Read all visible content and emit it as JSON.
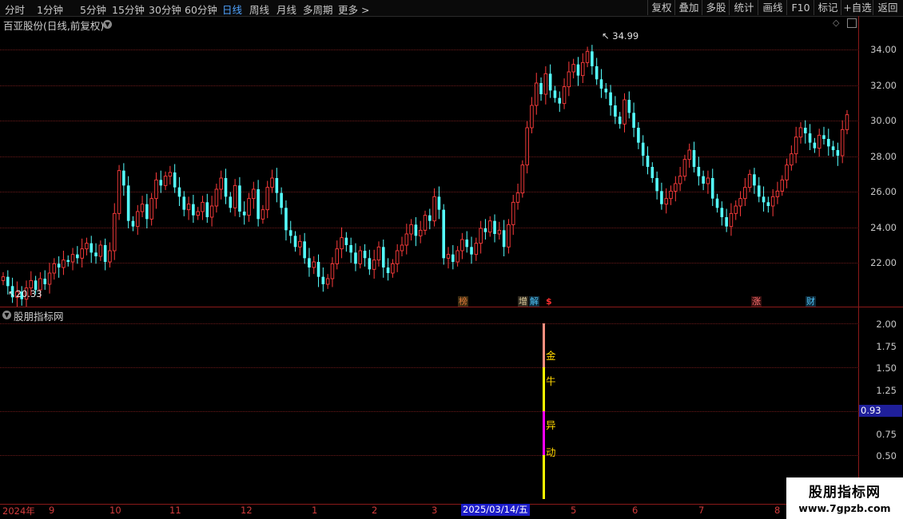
{
  "toolbar": {
    "periods": [
      "分时",
      "1分钟",
      "5分钟",
      "15分钟",
      "30分钟",
      "60分钟",
      "日线",
      "周线",
      "月线",
      "多周期",
      "更多 >"
    ],
    "active_period": "日线",
    "tools": [
      "复权",
      "叠加",
      "多股",
      "统计",
      "画线",
      "F10",
      "标记",
      "+自选",
      "返回"
    ]
  },
  "main_chart": {
    "title": "百亚股份(日线,前复权)",
    "high_label": "34.99",
    "low_label": "20.33",
    "event_markers": [
      {
        "text": "榜",
        "color": "#e07b39"
      },
      {
        "text": "增",
        "color": "#e0d0a0"
      },
      {
        "text": "解",
        "color": "#4fc3f7"
      },
      {
        "text": "$",
        "color": "#ff3030"
      },
      {
        "text": "涨",
        "color": "#ff7070"
      },
      {
        "text": "财",
        "color": "#4fc3f7"
      }
    ]
  },
  "indicator": {
    "title": "股朋指标网",
    "current_value": "0.93",
    "labels": [
      "金",
      "牛",
      "异",
      "动"
    ]
  },
  "date_cursor": "2025/03/14/五",
  "watermark": {
    "line1": "股朋指标网",
    "line2": "www.7gpzb.com"
  },
  "colors": {
    "up": "#ff3c3c",
    "down": "#55ffff",
    "grid": "#6e1a1a",
    "accent": "#4fa3ff"
  },
  "chart_data": [
    {
      "type": "candlestick",
      "ylim": [
        20.0,
        35.6
      ],
      "yticks": [
        "22.00",
        "24.00",
        "26.00",
        "28.00",
        "30.00",
        "32.00",
        "34.00"
      ],
      "xlabels": [
        "2024年",
        "9",
        "10",
        "11",
        "12",
        "1",
        "2",
        "3",
        "4",
        "5",
        "6",
        "7",
        "8"
      ],
      "close_series": [
        21.6,
        21.1,
        20.5,
        20.8,
        20.4,
        21.0,
        21.4,
        20.9,
        21.5,
        21.2,
        21.8,
        22.3,
        22.1,
        22.5,
        22.4,
        22.8,
        22.6,
        23.1,
        23.4,
        22.9,
        22.7,
        23.3,
        22.4,
        23.0,
        25.0,
        27.3,
        26.5,
        24.6,
        24.3,
        25.1,
        25.5,
        24.7,
        25.8,
        26.8,
        26.5,
        27.0,
        27.2,
        26.4,
        25.9,
        25.2,
        25.5,
        24.9,
        25.1,
        25.6,
        24.8,
        25.4,
        26.3,
        26.9,
        25.9,
        25.3,
        26.5,
        25.1,
        24.9,
        25.8,
        26.3,
        24.7,
        25.2,
        26.4,
        26.9,
        26.1,
        25.3,
        24.1,
        23.8,
        23.2,
        23.5,
        22.6,
        22.1,
        22.4,
        21.6,
        21.2,
        21.5,
        22.3,
        23.1,
        23.7,
        23.3,
        22.9,
        22.3,
        23.0,
        22.6,
        22.0,
        22.5,
        23.2,
        22.1,
        21.8,
        22.3,
        23.0,
        23.3,
        23.9,
        24.4,
        23.8,
        24.1,
        24.9,
        24.6,
        25.9,
        25.2,
        22.6,
        22.8,
        22.4,
        23.0,
        23.6,
        23.2,
        22.8,
        23.4,
        24.2,
        24.0,
        24.6,
        23.9,
        24.1,
        23.2,
        24.4,
        25.6,
        26.1,
        27.6,
        29.6,
        30.8,
        32.0,
        31.4,
        32.5,
        31.6,
        31.2,
        30.9,
        31.8,
        32.6,
        33.0,
        32.4,
        33.1,
        33.7,
        32.9,
        32.2,
        31.7,
        31.5,
        30.8,
        30.2,
        29.8,
        31.1,
        30.4,
        29.6,
        28.8,
        28.1,
        27.5,
        26.9,
        26.2,
        25.5,
        25.8,
        26.2,
        26.6,
        27.0,
        27.9,
        28.4,
        27.5,
        27.0,
        26.6,
        26.9,
        25.8,
        25.3,
        24.8,
        24.3,
        25.0,
        25.4,
        25.8,
        26.4,
        27.1,
        26.5,
        25.9,
        25.6,
        25.4,
        25.9,
        26.2,
        26.8,
        27.6,
        28.2,
        29.1,
        29.6,
        29.3,
        28.8,
        28.5,
        29.2,
        29.0,
        28.6,
        28.4,
        28.1,
        29.5,
        30.3
      ]
    },
    {
      "type": "bar",
      "ylim": [
        0,
        2.2
      ],
      "yticks": [
        "0.50",
        "0.75",
        "1.00",
        "1.25",
        "1.50",
        "1.75",
        "2.00"
      ],
      "segments": [
        {
          "from": 0,
          "to": 0.5,
          "color": "#ffff00"
        },
        {
          "from": 0.5,
          "to": 1.0,
          "color": "#ff00ff"
        },
        {
          "from": 1.0,
          "to": 1.5,
          "color": "#ffff00"
        },
        {
          "from": 1.5,
          "to": 2.0,
          "color": "#ff9080"
        }
      ]
    }
  ]
}
